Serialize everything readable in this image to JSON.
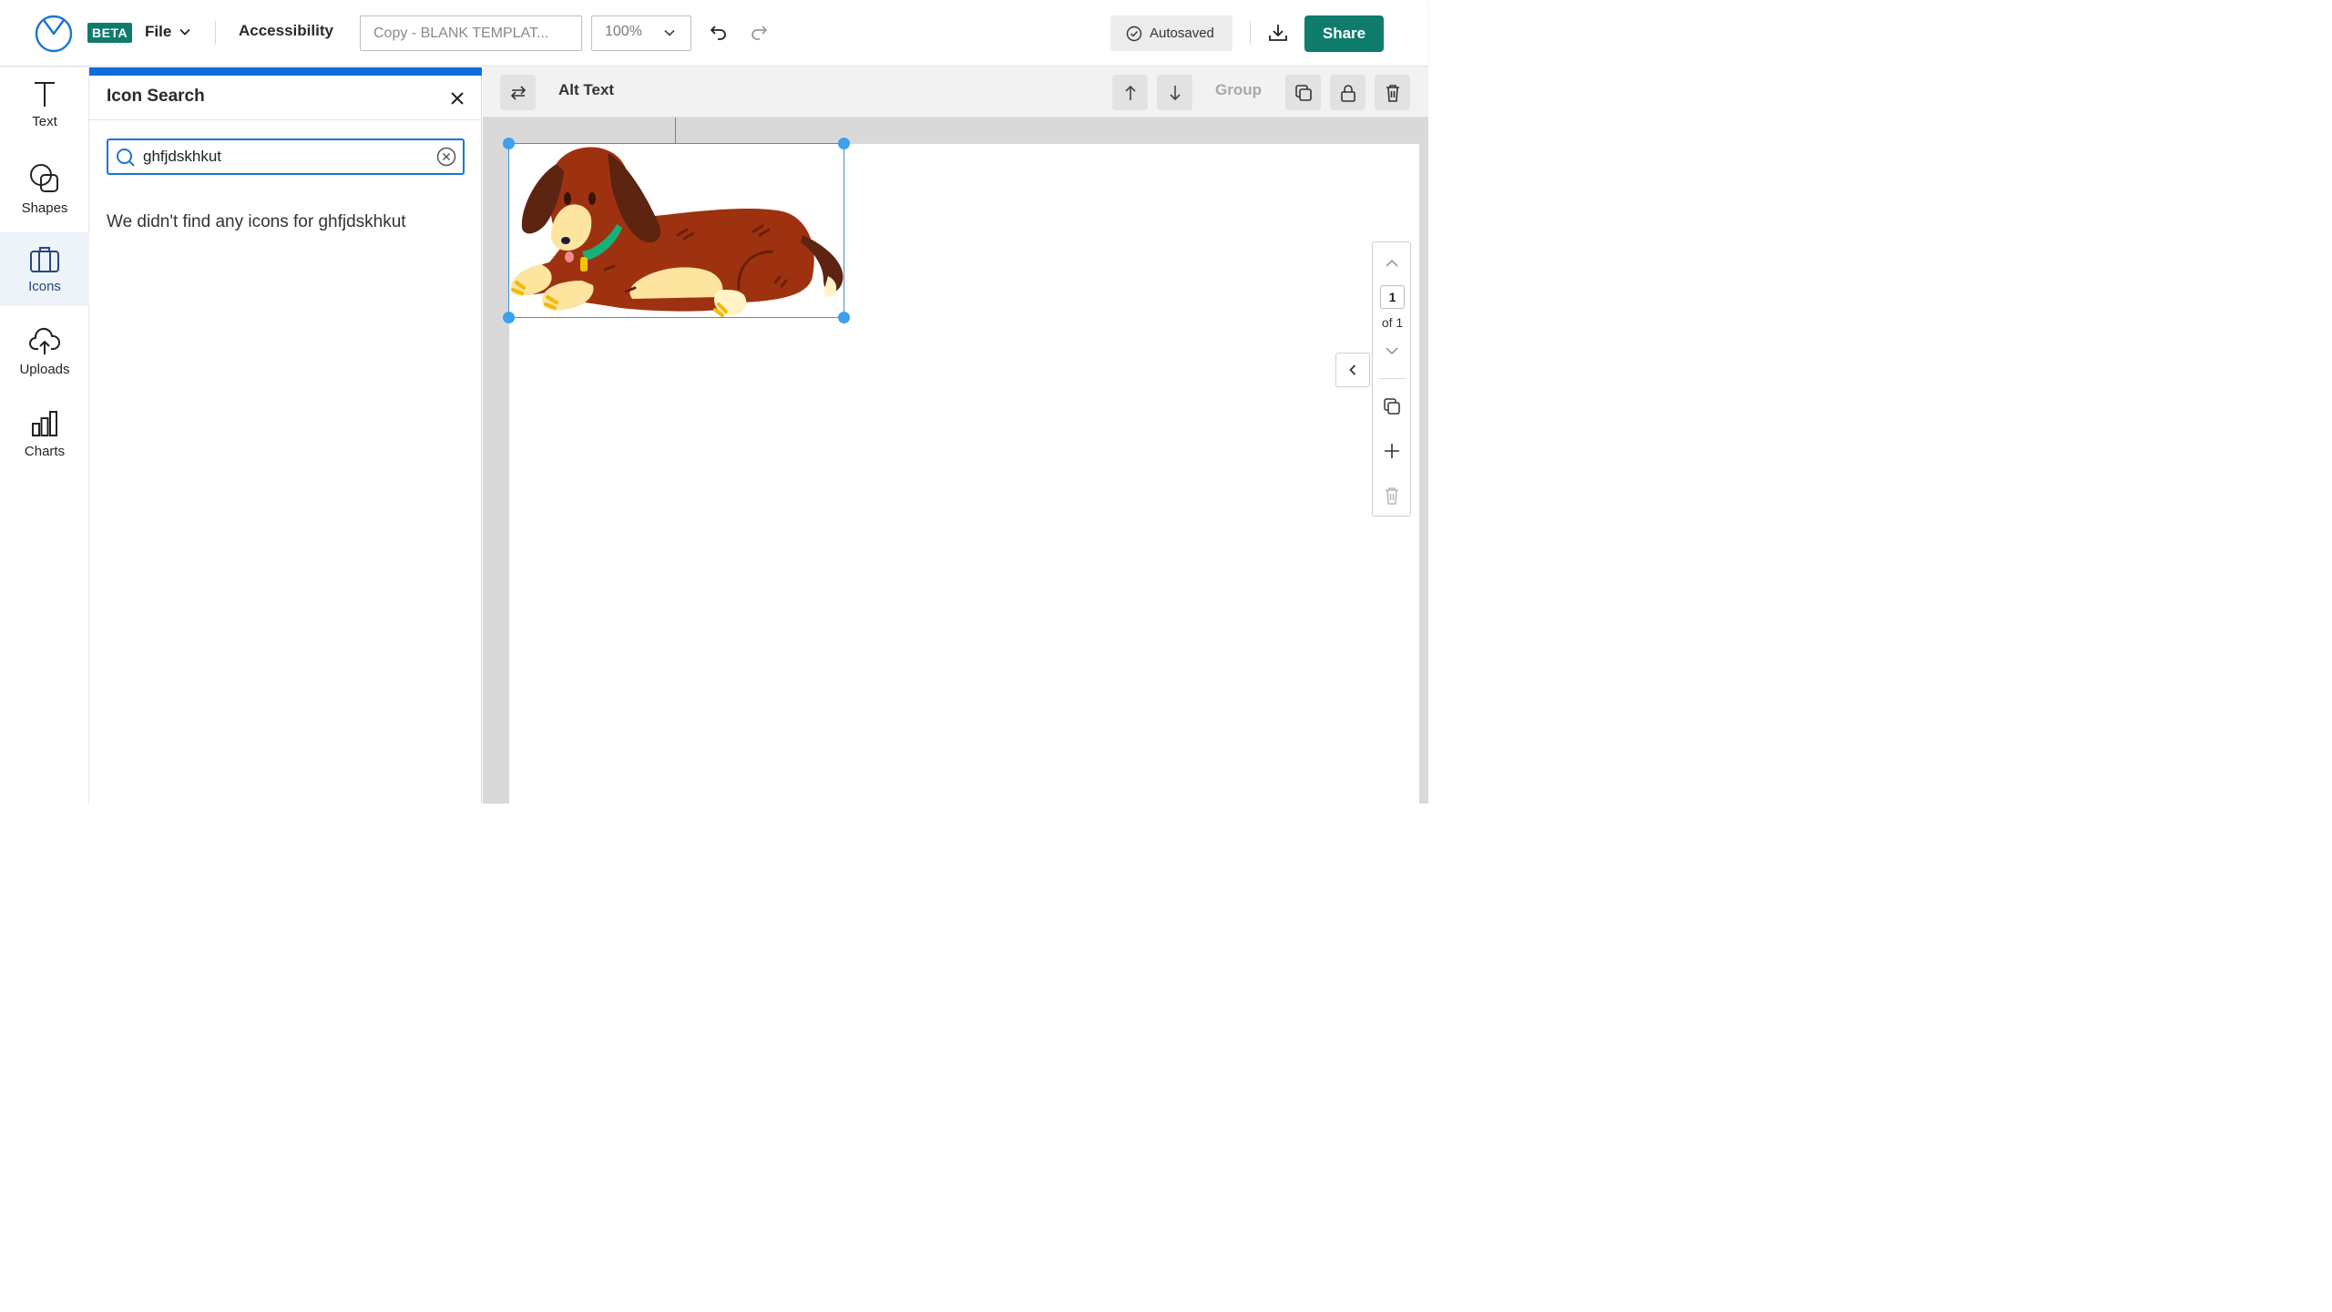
{
  "header": {
    "beta_label": "BETA",
    "file_label": "File",
    "accessibility_label": "Accessibility",
    "document_title": "Copy - BLANK TEMPLAT...",
    "zoom_value": "100%",
    "autosaved_label": "Autosaved",
    "share_label": "Share",
    "brand_color": "#0f7b6c"
  },
  "sidebar": {
    "items": [
      {
        "label": "Text",
        "icon": "text-icon"
      },
      {
        "label": "Shapes",
        "icon": "shapes-icon"
      },
      {
        "label": "Icons",
        "icon": "icons-icon",
        "active": true
      },
      {
        "label": "Uploads",
        "icon": "upload-cloud-icon"
      },
      {
        "label": "Charts",
        "icon": "bar-chart-icon"
      }
    ]
  },
  "panel": {
    "title": "Icon Search",
    "search_value": "ghfjdskhkut",
    "no_results_text": "We didn't find any icons for ghfjdskhkut",
    "accent_color": "#0e6ee0"
  },
  "toolbar": {
    "alt_text_label": "Alt Text",
    "group_label": "Group"
  },
  "pagenav": {
    "current_page": "1",
    "of_label": "of 1"
  }
}
